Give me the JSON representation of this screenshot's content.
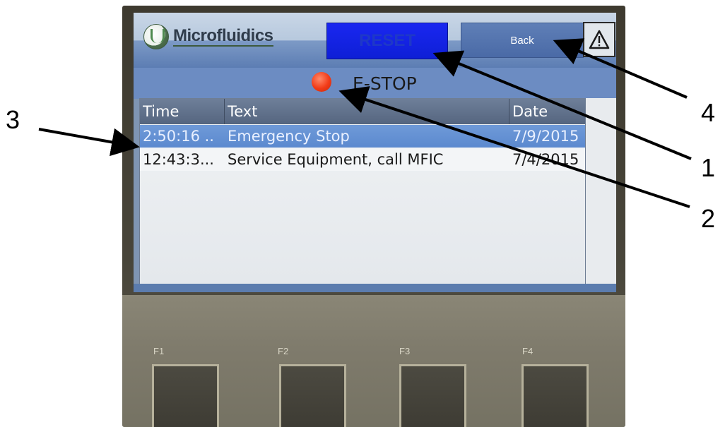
{
  "screen": {
    "brand": "Microfluidics",
    "reset_label": "RESET",
    "back_label": "Back",
    "status_label": "E-STOP",
    "status_color": "#f23b17"
  },
  "alarm_table": {
    "columns": [
      "Time",
      "Text",
      "Date"
    ],
    "rows": [
      {
        "time": "2:50:16 ..",
        "text": "Emergency Stop",
        "date": "7/9/2015",
        "selected": true
      },
      {
        "time": "12:43:3...",
        "text": "Service Equipment, call MFIC",
        "date": "7/4/2015",
        "selected": false
      }
    ]
  },
  "function_keys": [
    "F1",
    "F2",
    "F3",
    "F4"
  ],
  "annotations": {
    "callout_1": "1",
    "callout_2": "2",
    "callout_3": "3",
    "callout_4": "4"
  },
  "icons": {
    "warning": "warning-triangle-icon",
    "logo": "microfluidics-logo-icon",
    "status": "red-indicator-icon"
  },
  "colors": {
    "reset_button": "#0e1fd6",
    "selected_row": "#5b89cf",
    "header_bar": "#5c7db3"
  }
}
